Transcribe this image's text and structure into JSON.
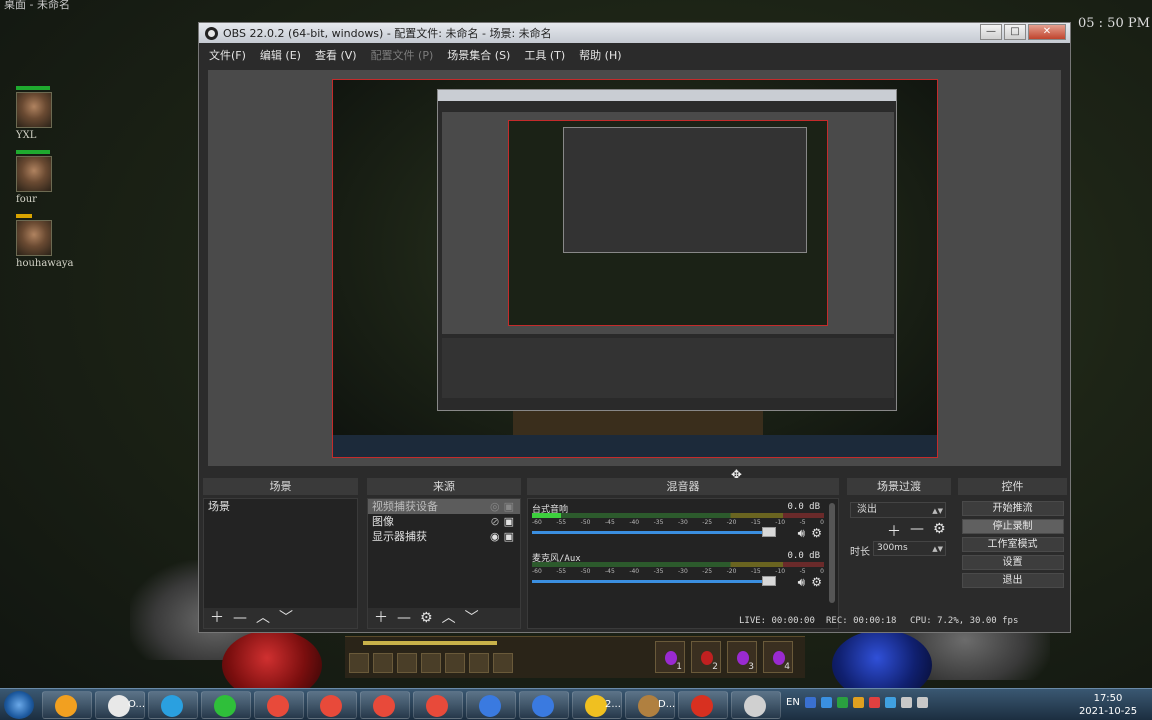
{
  "desktop": {
    "window_title_fragment": "桌面 - 未命名",
    "clock_overlay": "05 : 50 PM",
    "party": [
      {
        "name": "YXL",
        "health": 1.0
      },
      {
        "name": "four",
        "health": 1.0
      },
      {
        "name": "houhawaya",
        "health": 0.5
      }
    ]
  },
  "obs": {
    "title": "OBS 22.0.2 (64-bit, windows) - 配置文件: 未命名 - 场景: 未命名",
    "window_buttons": {
      "minimize": "—",
      "maximize": "□",
      "close": "✕"
    },
    "menu": [
      {
        "label": "文件(F)",
        "enabled": true
      },
      {
        "label": "编辑 (E)",
        "enabled": true
      },
      {
        "label": "查看 (V)",
        "enabled": true
      },
      {
        "label": "配置文件 (P)",
        "enabled": false
      },
      {
        "label": "场景集合 (S)",
        "enabled": true
      },
      {
        "label": "工具 (T)",
        "enabled": true
      },
      {
        "label": "帮助 (H)",
        "enabled": true
      }
    ],
    "docks": {
      "scenes": {
        "header": "场景",
        "items": [
          "场景"
        ]
      },
      "sources": {
        "header": "来源",
        "items": [
          {
            "label": "视频捕获设备",
            "selected": true
          },
          {
            "label": "图像",
            "selected": false
          },
          {
            "label": "显示器捕获",
            "selected": false
          }
        ]
      },
      "mixer": {
        "header": "混音器",
        "ticks": [
          "-60",
          "-55",
          "-50",
          "-45",
          "-40",
          "-35",
          "-30",
          "-25",
          "-20",
          "-15",
          "-10",
          "-5",
          "0"
        ],
        "channels": [
          {
            "name": "台式音响",
            "db": "0.0 dB",
            "level": 0.1,
            "volume": 1.0
          },
          {
            "name": "麦克风/Aux",
            "db": "0.0 dB",
            "level": 0.0,
            "volume": 1.0
          }
        ]
      },
      "transitions": {
        "header": "场景过渡",
        "selected": "淡出",
        "duration_label": "时长",
        "duration": "300ms"
      },
      "controls": {
        "header": "控件",
        "buttons": [
          {
            "label": "开始推流",
            "active": false
          },
          {
            "label": "停止录制",
            "active": true
          },
          {
            "label": "工作室模式",
            "active": false
          },
          {
            "label": "设置",
            "active": false
          },
          {
            "label": "退出",
            "active": false
          }
        ]
      }
    },
    "status": {
      "live": "LIVE: 00:00:00",
      "rec": "REC: 00:00:18",
      "cpu": "CPU: 7.2%, 30.00 fps"
    }
  },
  "hud": {
    "potion_slots": [
      "1",
      "2",
      "3",
      "4"
    ]
  },
  "taskbar": {
    "tasks": [
      {
        "label": "",
        "color": "#f2a020"
      },
      {
        "label": "O...",
        "color": "#e8e8e8"
      },
      {
        "label": "",
        "color": "#2aa0e0"
      },
      {
        "label": "",
        "color": "#2fbf3a"
      },
      {
        "label": "",
        "color": "#e84a3a"
      },
      {
        "label": "",
        "color": "#e84a3a"
      },
      {
        "label": "",
        "color": "#e84a3a"
      },
      {
        "label": "",
        "color": "#e84a3a"
      },
      {
        "label": "",
        "color": "#3a7ae0"
      },
      {
        "label": "",
        "color": "#3a7ae0"
      },
      {
        "label": "2...",
        "color": "#f0c020"
      },
      {
        "label": "D...",
        "color": "#b08040"
      },
      {
        "label": "",
        "color": "#d83020"
      },
      {
        "label": "",
        "color": "#d0d0d0"
      }
    ],
    "tray_lang": "EN",
    "time": "17:50",
    "date": "2021-10-25"
  },
  "colors": {
    "accent_red": "#c42b2b",
    "dock_bg": "#232323",
    "window_bg": "#2b2b2b",
    "volume_blue": "#3b8fe0"
  }
}
